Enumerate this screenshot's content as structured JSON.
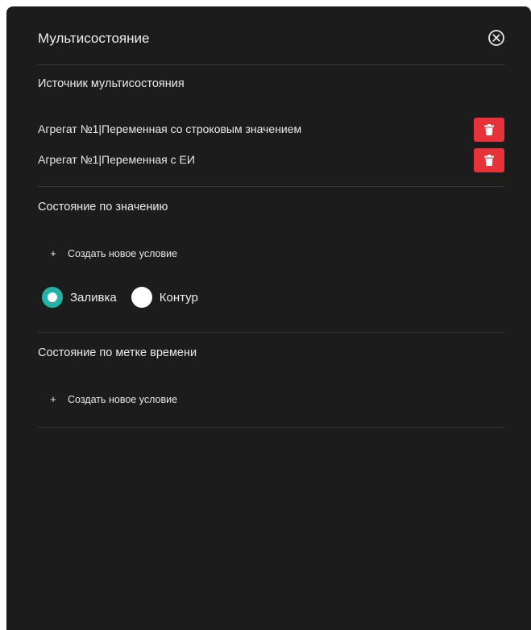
{
  "dialog": {
    "title": "Мультисостояние"
  },
  "source_section": {
    "title": "Источник мультисостояния",
    "items": [
      {
        "label": "Агрегат №1|Переменная со строковым значением"
      },
      {
        "label": "Агрегат №1|Переменная с ЕИ"
      }
    ]
  },
  "value_state_section": {
    "title": "Состояние по значению",
    "create_label": "Создать новое условие",
    "mode_options": [
      {
        "label": "Заливка",
        "checked": true
      },
      {
        "label": "Контур",
        "checked": false
      }
    ]
  },
  "time_state_section": {
    "title": "Состояние по метке времени",
    "create_label": "Создать новое условие"
  },
  "colors": {
    "panel_bg": "#1c1c1c",
    "delete_red": "#e8323a",
    "radio_accent": "#22b3a6"
  },
  "icons": {
    "close": "close-circle-icon",
    "delete": "trash-icon",
    "add": "plus-icon"
  }
}
